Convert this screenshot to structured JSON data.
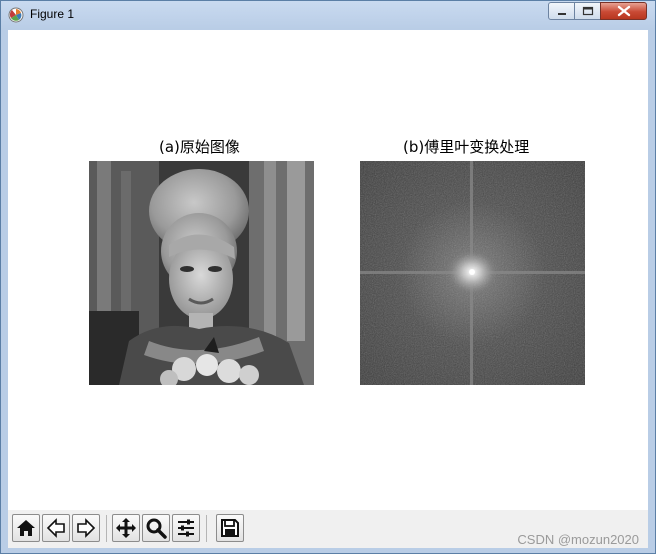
{
  "window": {
    "title": "Figure 1",
    "icon": "matplotlib-logo-icon",
    "controls": [
      "minimize-icon",
      "maximize-icon",
      "close-icon"
    ]
  },
  "figure": {
    "subplots": [
      {
        "title": "(a)原始图像",
        "content": "grayscale-photo-woman"
      },
      {
        "title": "(b)傅里叶变换处理",
        "content": "fourier-magnitude-spectrum"
      }
    ]
  },
  "toolbar": {
    "buttons": [
      {
        "icon": "home-icon"
      },
      {
        "icon": "back-arrow-icon"
      },
      {
        "icon": "forward-arrow-icon"
      },
      {
        "icon": "pan-move-icon"
      },
      {
        "icon": "zoom-magnifier-icon"
      },
      {
        "icon": "configure-subplots-icon"
      },
      {
        "icon": "save-disk-icon"
      }
    ]
  },
  "watermark": "CSDN @mozun2020",
  "colors": {
    "titlebar": "#c9daf0",
    "close_button": "#c94a35",
    "toolbar_bg": "#f0f0f0"
  }
}
